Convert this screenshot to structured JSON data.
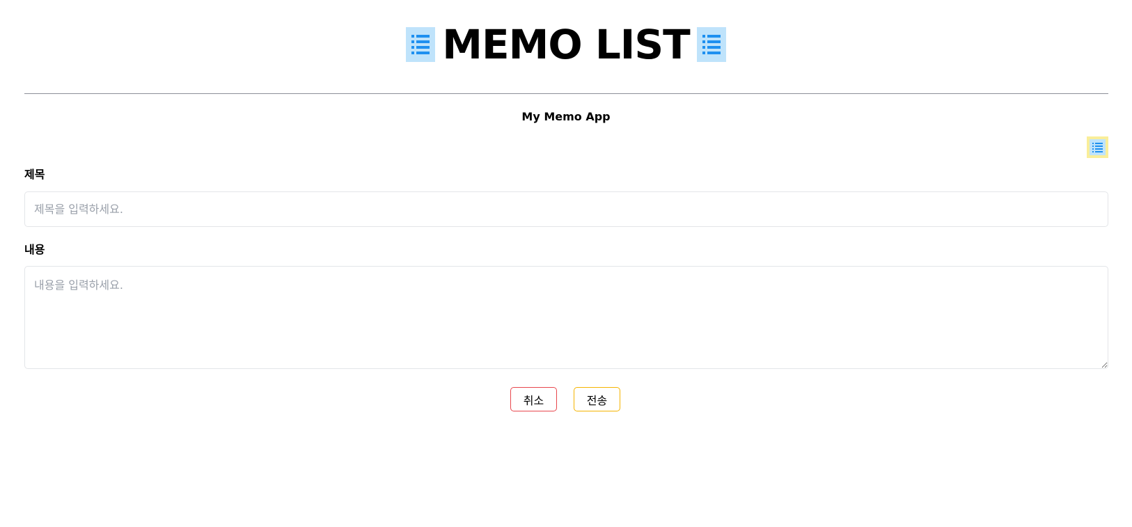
{
  "header": {
    "title": "MEMO LIST",
    "left_icon": "list-emoji-icon",
    "right_icon": "list-emoji-icon"
  },
  "subtitle": "My Memo App",
  "list_toggle": {
    "icon": "list-emoji-icon"
  },
  "form": {
    "title_label": "제목",
    "title_placeholder": "제목을 입력하세요.",
    "title_value": "",
    "content_label": "내용",
    "content_placeholder": "내용을 입력하세요.",
    "content_value": ""
  },
  "buttons": {
    "cancel_label": "취소",
    "submit_label": "전송"
  },
  "colors": {
    "icon_background": "#bfe3fb",
    "icon_glyph": "#1e90f0",
    "toggle_highlight": "#f9ee9a",
    "cancel_border": "#e8474d",
    "submit_border": "#f5b400",
    "divider": "#8b8f98"
  }
}
